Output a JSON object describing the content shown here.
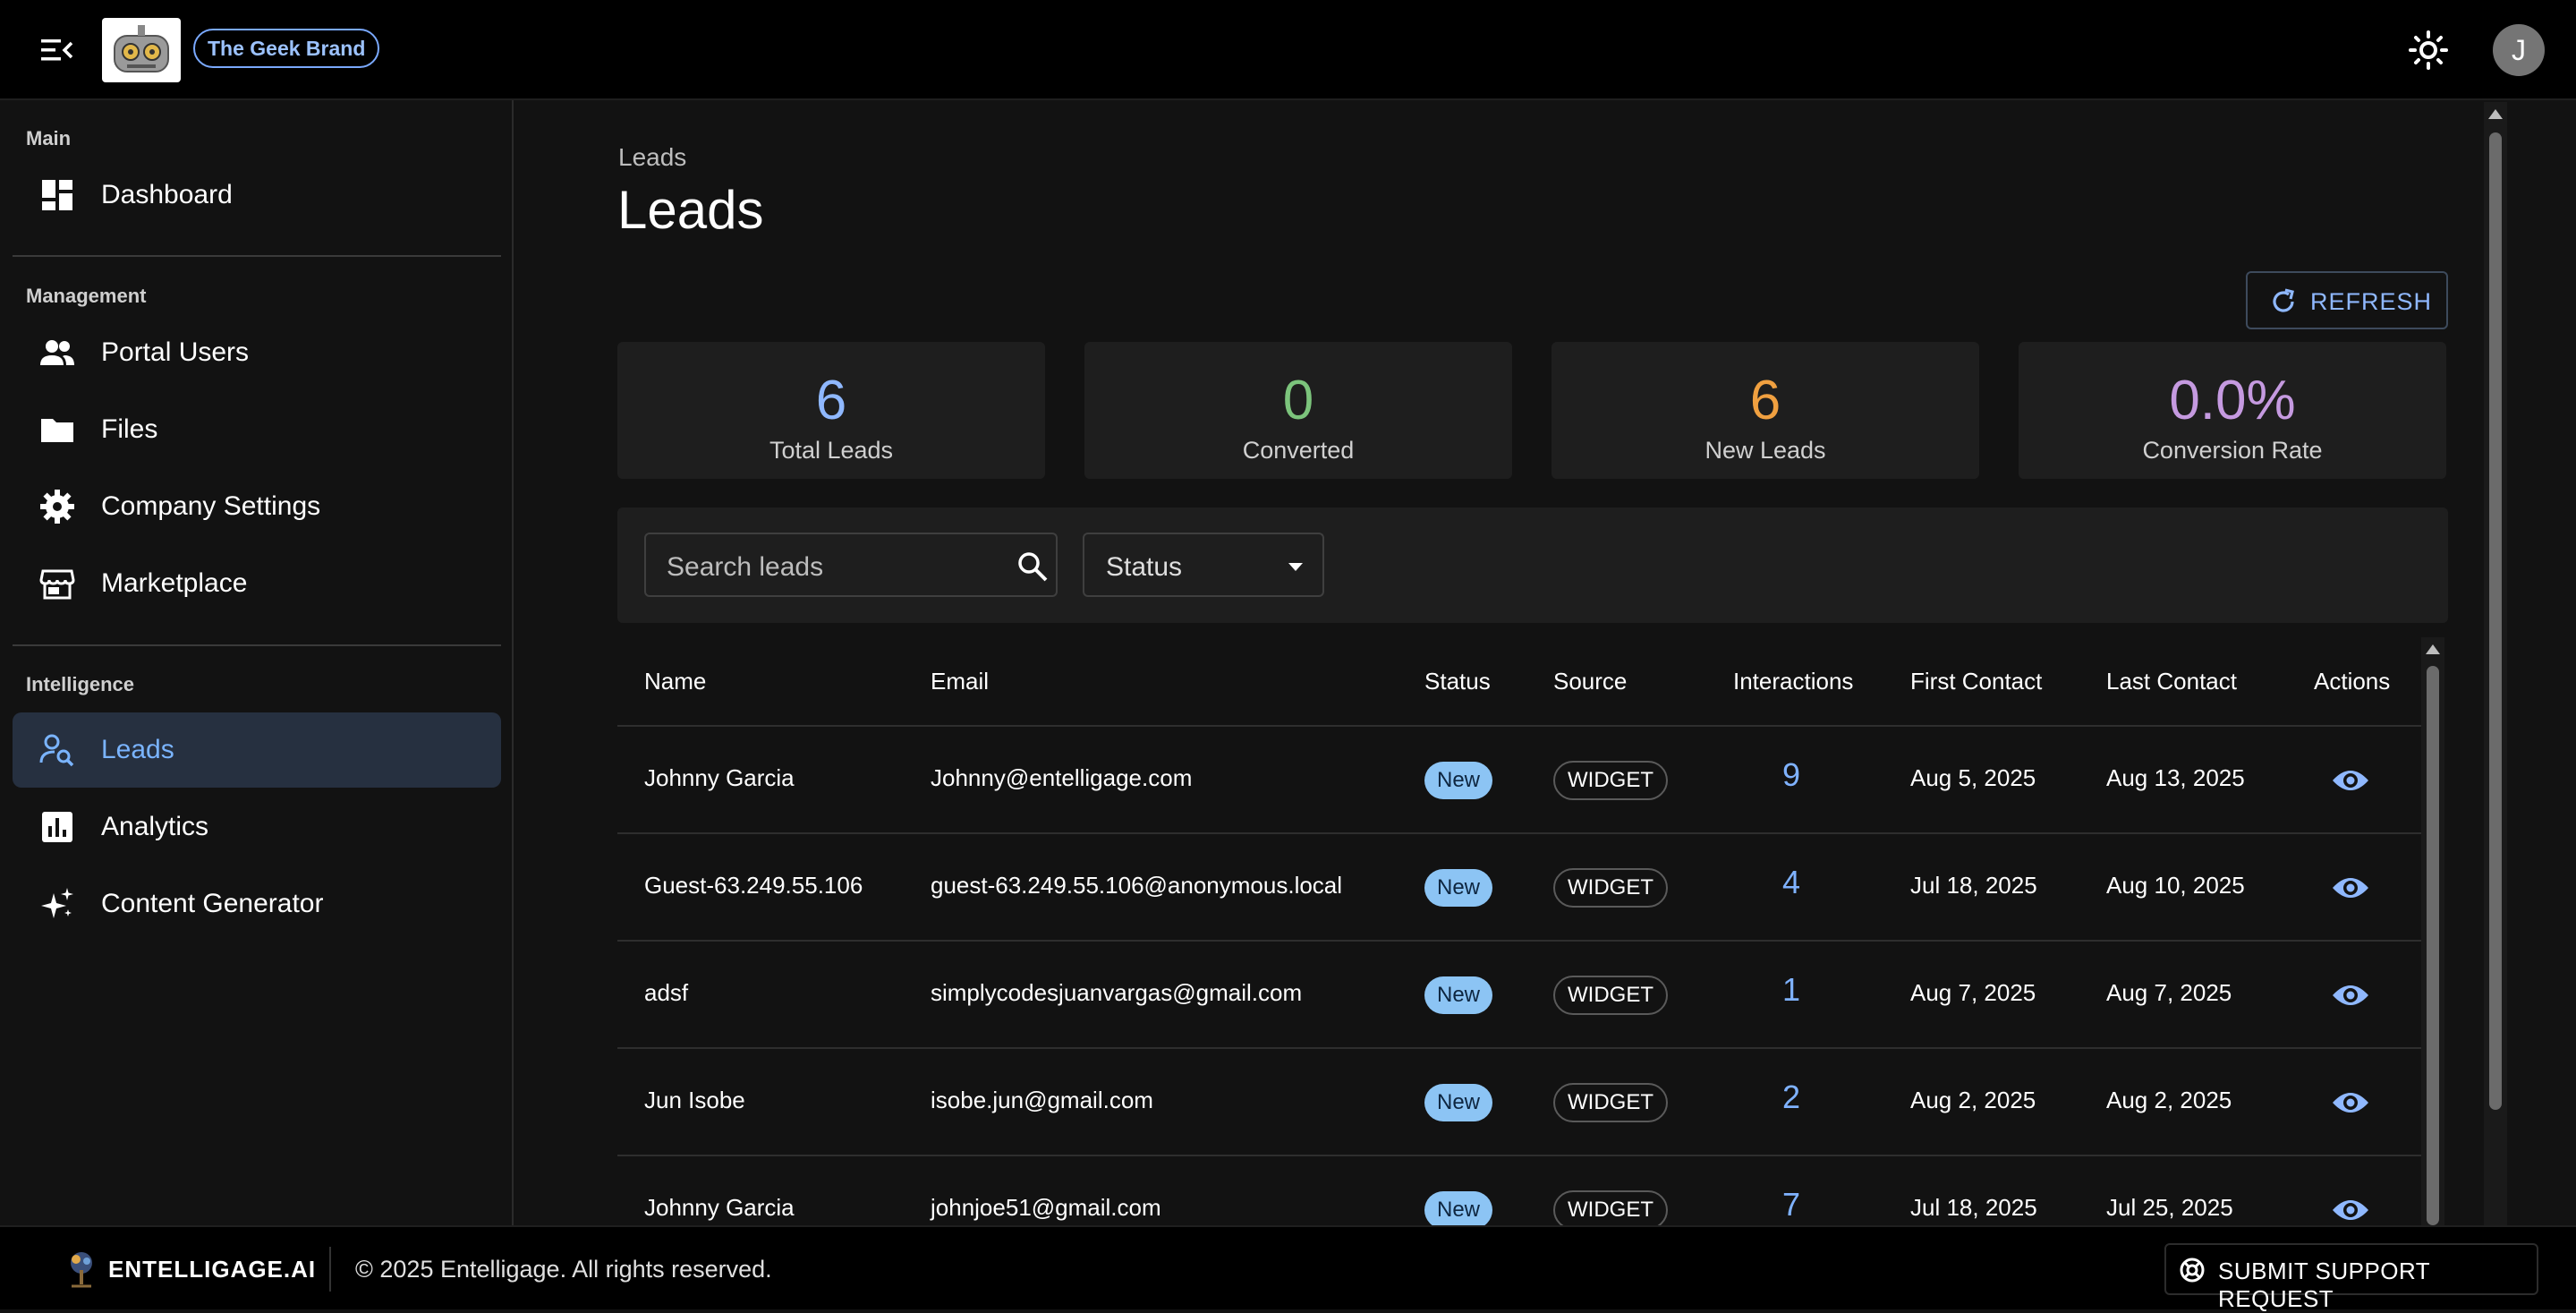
{
  "header": {
    "brand_chip": "The Geek Brand",
    "avatar_initial": "J"
  },
  "sidebar": {
    "sections": {
      "main": "Main",
      "management": "Management",
      "intelligence": "Intelligence"
    },
    "items": [
      {
        "label": "Dashboard",
        "icon": "dashboard-icon"
      },
      {
        "label": "Portal Users",
        "icon": "people-icon"
      },
      {
        "label": "Files",
        "icon": "folder-icon"
      },
      {
        "label": "Company Settings",
        "icon": "gear-icon"
      },
      {
        "label": "Marketplace",
        "icon": "store-icon"
      },
      {
        "label": "Leads",
        "icon": "person-search-icon",
        "active": true
      },
      {
        "label": "Analytics",
        "icon": "bar-chart-icon"
      },
      {
        "label": "Content Generator",
        "icon": "sparkle-icon"
      }
    ]
  },
  "main": {
    "breadcrumb": "Leads",
    "title": "Leads",
    "refresh_label": "REFRESH",
    "stats": [
      {
        "value": "6",
        "label": "Total Leads",
        "color": "#8fb8ff"
      },
      {
        "value": "0",
        "label": "Converted",
        "color": "#7cc47c"
      },
      {
        "value": "6",
        "label": "New Leads",
        "color": "#f0a040"
      },
      {
        "value": "0.0%",
        "label": "Conversion Rate",
        "color": "#c59ae0"
      }
    ],
    "search_placeholder": "Search leads",
    "status_filter_label": "Status"
  },
  "table": {
    "columns": [
      "Name",
      "Email",
      "Status",
      "Source",
      "Interactions",
      "First Contact",
      "Last Contact",
      "Actions"
    ],
    "rows": [
      {
        "name": "Johnny Garcia",
        "email": "Johnny@entelligage.com",
        "status": "New",
        "source": "WIDGET",
        "interactions": "9",
        "first_contact": "Aug 5, 2025",
        "last_contact": "Aug 13, 2025"
      },
      {
        "name": "Guest-63.249.55.106",
        "email": "guest-63.249.55.106@anonymous.local",
        "status": "New",
        "source": "WIDGET",
        "interactions": "4",
        "first_contact": "Jul 18, 2025",
        "last_contact": "Aug 10, 2025"
      },
      {
        "name": "adsf",
        "email": "simplycodesjuanvargas@gmail.com",
        "status": "New",
        "source": "WIDGET",
        "interactions": "1",
        "first_contact": "Aug 7, 2025",
        "last_contact": "Aug 7, 2025"
      },
      {
        "name": "Jun Isobe",
        "email": "isobe.jun@gmail.com",
        "status": "New",
        "source": "WIDGET",
        "interactions": "2",
        "first_contact": "Aug 2, 2025",
        "last_contact": "Aug 2, 2025"
      },
      {
        "name": "Johnny Garcia",
        "email": "johnjoe51@gmail.com",
        "status": "New",
        "source": "WIDGET",
        "interactions": "7",
        "first_contact": "Jul 18, 2025",
        "last_contact": "Jul 25, 2025"
      }
    ]
  },
  "footer": {
    "brand": "ENTELLIGAGE.AI",
    "copyright": "© 2025 Entelligage. All rights reserved.",
    "support_label": "SUBMIT SUPPORT REQUEST"
  }
}
